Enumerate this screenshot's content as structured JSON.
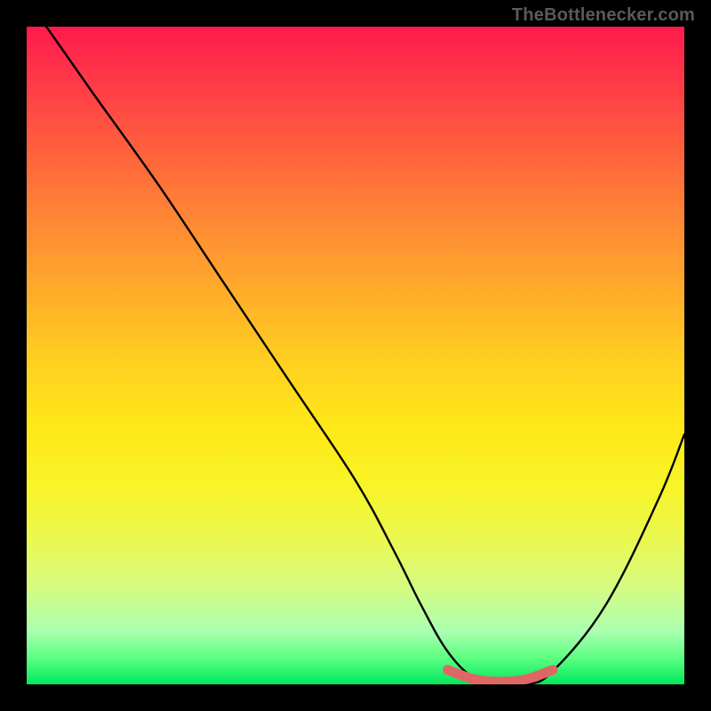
{
  "credit": "TheBottlenecker.com",
  "chart_data": {
    "type": "line",
    "title": "",
    "xlabel": "",
    "ylabel": "",
    "xlim": [
      0,
      100
    ],
    "ylim": [
      0,
      100
    ],
    "series": [
      {
        "name": "curve",
        "x": [
          3,
          10,
          20,
          30,
          40,
          50,
          56,
          60,
          64,
          68,
          72,
          76,
          80,
          88,
          96,
          100
        ],
        "y": [
          100,
          90,
          76,
          61,
          46,
          31,
          20,
          12,
          5,
          1,
          0,
          0,
          2,
          12,
          28,
          38
        ]
      },
      {
        "name": "highlight",
        "x": [
          64,
          68,
          72,
          76,
          80
        ],
        "y": [
          2.2,
          0.8,
          0.4,
          0.8,
          2.2
        ]
      }
    ],
    "colors": {
      "curve": "#000000",
      "highlight": "#e06666",
      "background_top": "#ff1a4d",
      "background_bottom": "#00e85c"
    }
  }
}
